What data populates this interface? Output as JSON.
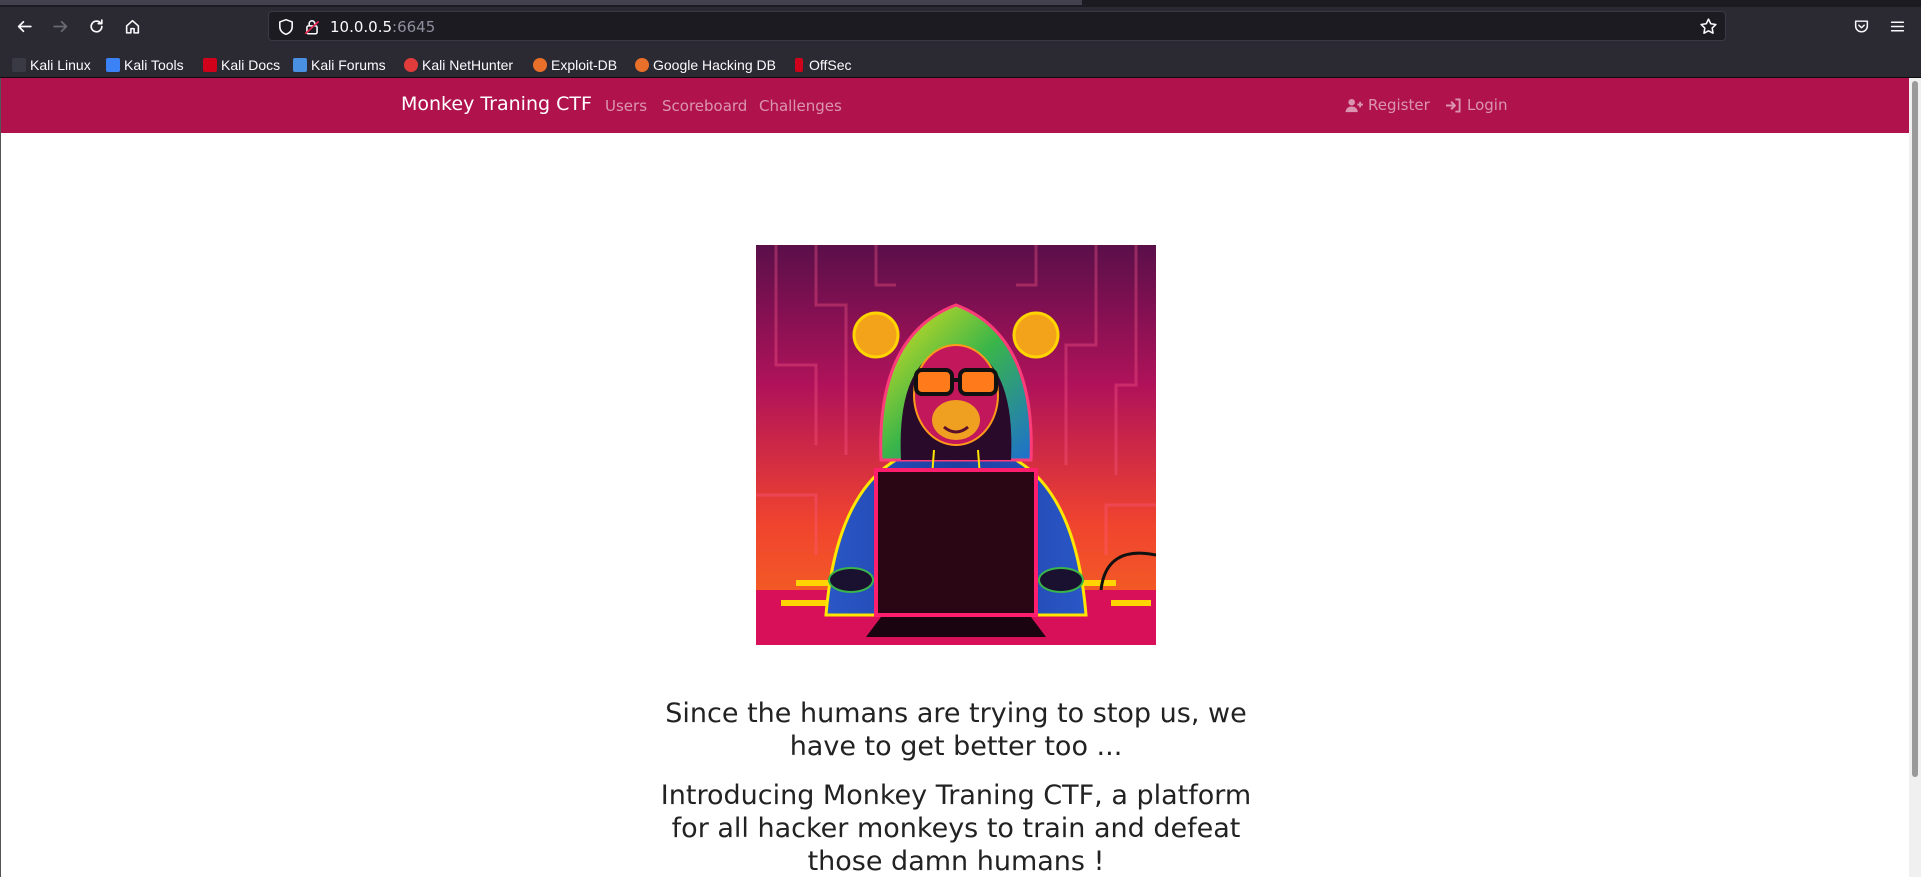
{
  "browser": {
    "url_host": "10.0.0.5",
    "url_port": ":6645"
  },
  "bookmarks": [
    {
      "label": "Kali Linux",
      "color": "#367bf0"
    },
    {
      "label": "Kali Tools",
      "color": "#3b82f6"
    },
    {
      "label": "Kali Docs",
      "color": "#d0021b"
    },
    {
      "label": "Kali Forums",
      "color": "#4a90e2"
    },
    {
      "label": "Kali NetHunter",
      "color": "#e23b3b"
    },
    {
      "label": "Exploit-DB",
      "color": "#e8702a"
    },
    {
      "label": "Google Hacking DB",
      "color": "#e8702a"
    },
    {
      "label": "OffSec",
      "color": "#d0021b"
    }
  ],
  "site": {
    "brand": "Monkey Traning CTF",
    "nav": [
      "Users",
      "Scoreboard",
      "Challenges"
    ],
    "register": "Register",
    "login": "Login",
    "accent_color": "#b0124c"
  },
  "content": {
    "paragraph1": "Since the humans are trying to stop us, we have to get better too ...",
    "paragraph2": "Introducing Monkey Traning CTF, a platform for all hacker monkeys to train and defeat those damn humans !"
  }
}
